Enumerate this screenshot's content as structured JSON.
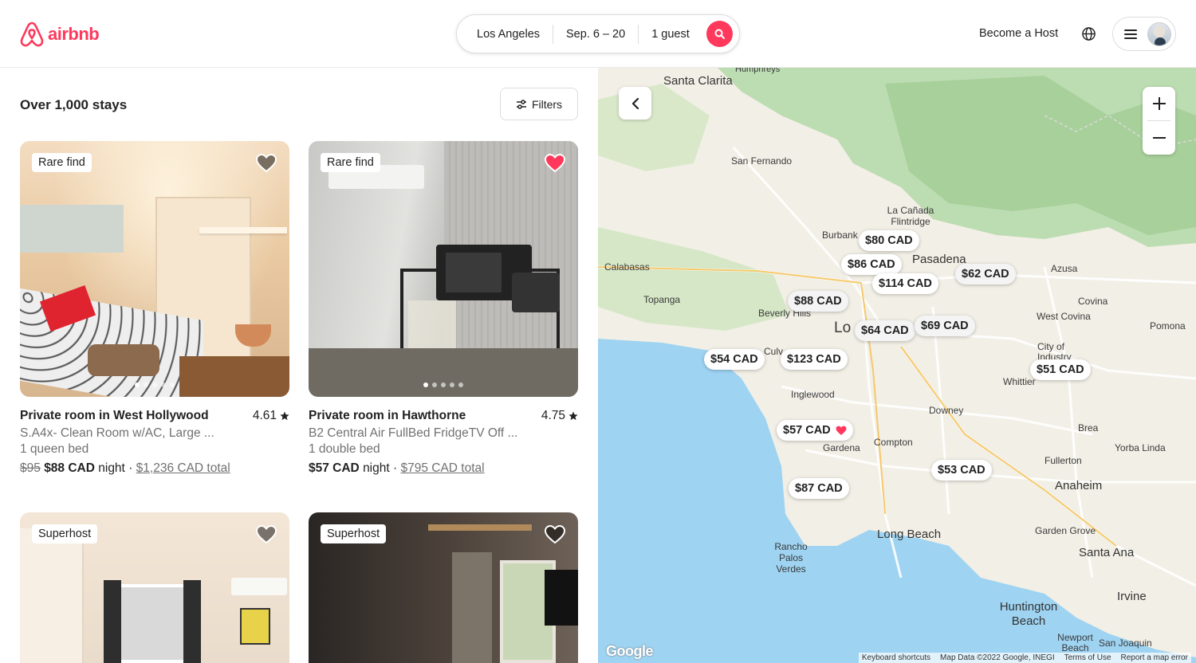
{
  "header": {
    "logo_text": "airbnb",
    "search": {
      "location": "Los Angeles",
      "dates": "Sep. 6 – 20",
      "guests": "1 guest"
    },
    "become_host": "Become a Host",
    "brand_color": "#ff385c"
  },
  "results": {
    "count_text": "Over 1,000 stays",
    "filters_label": "Filters"
  },
  "listings": [
    {
      "badge": "Rare find",
      "favorited": false,
      "title": "Private room in West Hollywood",
      "rating": "4.61",
      "subtitle": "S.A4x- Clean Room w/AC, Large ...",
      "beds": "1 queen bed",
      "old_price": "$95",
      "price": "$88 CAD",
      "price_unit": "night",
      "sep": "·",
      "total": "$1,236 CAD total"
    },
    {
      "badge": "Rare find",
      "favorited": true,
      "title": "Private room in Hawthorne",
      "rating": "4.75",
      "subtitle": "B2 Central Air FullBed  FridgeTV Off ...",
      "beds": "1 double bed",
      "old_price": "",
      "price": "$57 CAD",
      "price_unit": "night",
      "sep": "·",
      "total": "$795 CAD total"
    },
    {
      "badge": "Superhost",
      "favorited": false
    },
    {
      "badge": "Superhost",
      "favorited": false
    }
  ],
  "map": {
    "pins": [
      {
        "label": "$80 CAD"
      },
      {
        "label": "$86 CAD"
      },
      {
        "label": "$114 CAD"
      },
      {
        "label": "$62 CAD"
      },
      {
        "label": "$88 CAD"
      },
      {
        "label": "$64 CAD"
      },
      {
        "label": "$69 CAD"
      },
      {
        "label": "$54 CAD"
      },
      {
        "label": "$123 CAD"
      },
      {
        "label": "$51 CAD"
      },
      {
        "label": "$57 CAD"
      },
      {
        "label": "$53 CAD"
      },
      {
        "label": "$87 CAD"
      }
    ],
    "places": {
      "santa_clarita": "Santa Clarita",
      "san_fernando": "San Fernando",
      "la_canada": "La Cañada Flintridge",
      "burbank": "Burbank",
      "pasadena": "Pasadena",
      "calabasas": "Calabasas",
      "azusa": "Azusa",
      "topanga": "Topanga",
      "covina": "Covina",
      "west_covina": "West Covina",
      "pomona": "Pomona",
      "city_of_industry": "City of Industry",
      "whittier": "Whittier",
      "inglewood": "Inglewood",
      "downey": "Downey",
      "brea": "Brea",
      "yorba_linda": "Yorba Linda",
      "fullerton": "Fullerton",
      "anaheim": "Anaheim",
      "garden_grove": "Garden Grove",
      "santa_ana": "Santa Ana",
      "long_beach": "Long Beach",
      "rancho_palos_verdes": "Rancho Palos Verdes",
      "irvine": "Irvine",
      "huntington_beach": "Huntington Beach",
      "newport_beach": "Newport Beach",
      "san_joaquin": "San Joaquin",
      "compton": "Compton",
      "gardena": "Gardena",
      "beverly_hills": "Beverly Hills",
      "culver": "Culv",
      "humphreys": "Humphreys",
      "los": "Lo"
    },
    "attribution": {
      "keyboard": "Keyboard shortcuts",
      "data": "Map Data ©2022 Google, INEGI",
      "terms": "Terms of Use",
      "report": "Report a map error"
    },
    "google_logo": "Google"
  }
}
